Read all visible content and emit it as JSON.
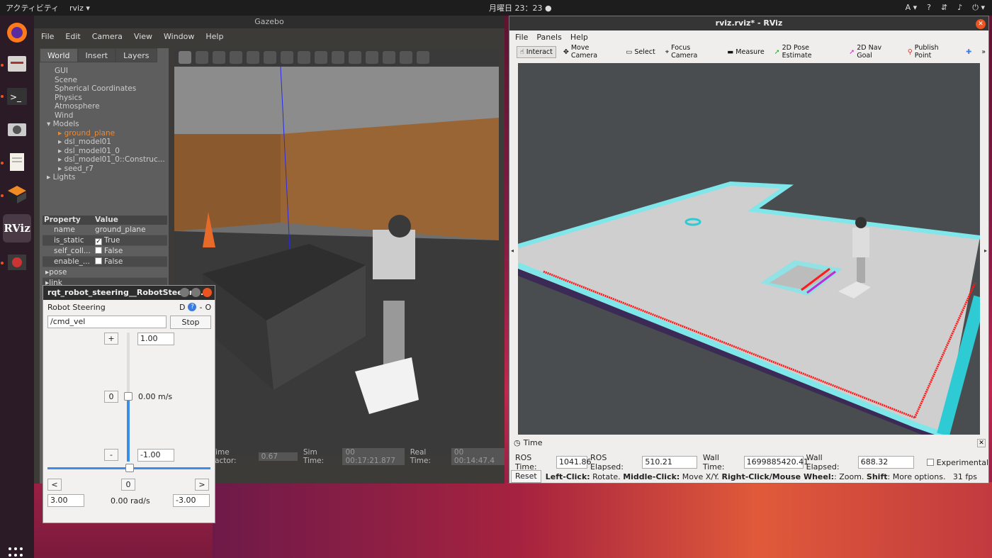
{
  "topbar": {
    "activities": "アクティビティ",
    "app_name": "rviz ▾",
    "clock": "月曜日 23：23 ●",
    "input_method": "A ▾"
  },
  "gazebo": {
    "title": "Gazebo",
    "menu": [
      "File",
      "Edit",
      "Camera",
      "View",
      "Window",
      "Help"
    ],
    "tabs": [
      "World",
      "Insert",
      "Layers"
    ],
    "tree": {
      "top": [
        "GUI",
        "Scene",
        "Spherical Coordinates",
        "Physics",
        "Atmosphere",
        "Wind"
      ],
      "models_label": "Models",
      "models": [
        "ground_plane",
        "dsl_model01",
        "dsl_model01_0",
        "dsl_model01_0::Construc...",
        "seed_r7"
      ],
      "lights_label": "Lights"
    },
    "properties": {
      "header_property": "Property",
      "header_value": "Value",
      "rows": [
        {
          "name": "name",
          "value": "ground_plane"
        },
        {
          "name": "is_static",
          "value": "True"
        },
        {
          "name": "self_coll...",
          "value": "False"
        },
        {
          "name": "enable_...",
          "value": "False"
        }
      ],
      "pose": "pose",
      "link": "link"
    },
    "status": {
      "time_factor_label": "Time Factor:",
      "time_factor": "0.67",
      "sim_time_label": "Sim Time:",
      "sim_time": "00 00:17:21.877",
      "real_time_label": "Real Time:",
      "real_time": "00 00:14:47.4"
    }
  },
  "steering": {
    "title": "rqt_robot_steering__RobotSteerin...",
    "heading": "Robot Steering",
    "topic": "/cmd_vel",
    "stop_label": "Stop",
    "plus_label": "+",
    "minus_label": "-",
    "zero_label": "0",
    "max_linear": "1.00",
    "min_linear": "-1.00",
    "linear_value": "0.00 m/s",
    "left_label": "<",
    "right_label": ">",
    "max_angular": "3.00",
    "min_angular": "-3.00",
    "angular_value": "0.00 rad/s",
    "d_label": "D",
    "help_label": "?",
    "dash": "-",
    "o_label": "O"
  },
  "rviz": {
    "title": "rviz.rviz* - RViz",
    "menu": [
      "File",
      "Panels",
      "Help"
    ],
    "tools": [
      "Interact",
      "Move Camera",
      "Select",
      "Focus Camera",
      "Measure",
      "2D Pose Estimate",
      "2D Nav Goal",
      "Publish Point"
    ],
    "time_panel": {
      "title": "Time",
      "ros_time_label": "ROS Time:",
      "ros_time": "1041.86",
      "ros_elapsed_label": "ROS Elapsed:",
      "ros_elapsed": "510.21",
      "wall_time_label": "Wall Time:",
      "wall_time": "1699885420.41",
      "wall_elapsed_label": "Wall Elapsed:",
      "wall_elapsed": "688.32",
      "experimental_label": "Experimental"
    },
    "reset_label": "Reset",
    "hint_left": "Left-Click:",
    "hint_left_t": " Rotate. ",
    "hint_mid": "Middle-Click:",
    "hint_mid_t": " Move X/Y. ",
    "hint_right": "Right-Click/Mouse Wheel:",
    "hint_right_t": ": Zoom. ",
    "hint_shift": "Shift",
    "hint_shift_t": ": More options.",
    "fps": "31 fps"
  },
  "colors": {
    "accent": "#e95420",
    "laser": "#ff1a1a",
    "costmap": "#7fe6ea"
  }
}
